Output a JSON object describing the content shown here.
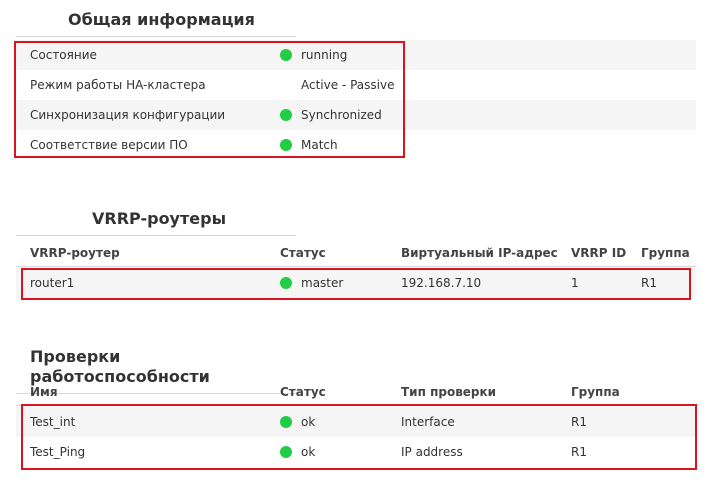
{
  "status_color": "#22cc44",
  "highlight_color": "#d9141e",
  "general": {
    "title": "Общая информация",
    "rows": [
      {
        "label": "Состояние",
        "value": "running",
        "status": "green"
      },
      {
        "label": "Режим работы HA-кластера",
        "value": "Active - Passive",
        "status": "none"
      },
      {
        "label": "Синхронизация конфигурации",
        "value": "Synchronized",
        "status": "green"
      },
      {
        "label": "Соответствие версии ПО",
        "value": "Match",
        "status": "green"
      }
    ]
  },
  "vrrp": {
    "title": "VRRP-роутеры",
    "columns": [
      "VRRP-роутер",
      "Статус",
      "Виртуальный IP-адрес",
      "VRRP ID",
      "Группа"
    ],
    "rows": [
      {
        "name": "router1",
        "status": "master",
        "ip": "192.168.7.10",
        "vrrp_id": "1",
        "group": "R1"
      }
    ]
  },
  "health": {
    "title": "Проверки работоспособности",
    "columns": [
      "Имя",
      "Статус",
      "Тип проверки",
      "Группа"
    ],
    "rows": [
      {
        "name": "Test_int",
        "status": "ok",
        "type": "Interface",
        "group": "R1"
      },
      {
        "name": "Test_Ping",
        "status": "ok",
        "type": "IP address",
        "group": "R1"
      }
    ]
  }
}
